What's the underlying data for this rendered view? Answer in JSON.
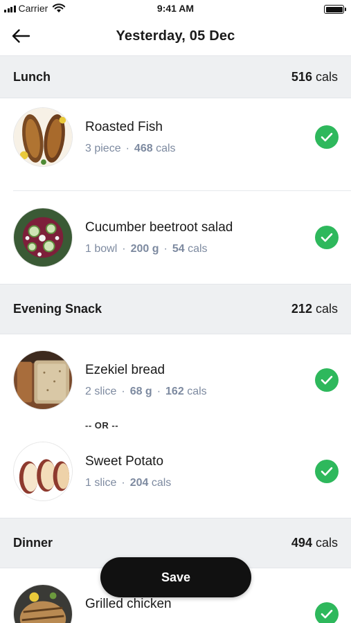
{
  "status_bar": {
    "carrier": "Carrier",
    "time": "9:41 AM"
  },
  "header": {
    "title": "Yesterday, 05 Dec"
  },
  "sections": [
    {
      "title": "Lunch",
      "cals_value": "516",
      "cals_unit": "cals",
      "items": [
        {
          "name": "Roasted Fish",
          "qty": "3 piece",
          "cals": "468",
          "unit": "cals",
          "checked": true
        },
        {
          "name": "Cucumber beetroot salad",
          "qty": "1 bowl",
          "weight": "200 g",
          "cals": "54",
          "unit": "cals",
          "checked": true
        }
      ]
    },
    {
      "title": "Evening Snack",
      "cals_value": "212",
      "cals_unit": "cals",
      "items": [
        {
          "name": "Ezekiel bread",
          "qty": "2 slice",
          "weight": "68 g",
          "cals": "162",
          "unit": "cals",
          "checked": true
        },
        {
          "name": "Sweet Potato",
          "qty": "1 slice",
          "cals": "204",
          "unit": "cals",
          "checked": true
        }
      ],
      "or_label": "-- OR --"
    },
    {
      "title": "Dinner",
      "cals_value": "494",
      "cals_unit": "cals",
      "items": [
        {
          "name": "Grilled chicken",
          "checked": true
        }
      ]
    }
  ],
  "save_button": {
    "label": "Save"
  },
  "colors": {
    "accent_green": "#2eb85c",
    "section_bg": "#eef0f2",
    "meta_text": "#7d8aa0",
    "button_bg": "#111111"
  },
  "icons": {
    "back": "arrow-left-icon",
    "check": "check-circle-icon",
    "wifi": "wifi-icon",
    "battery": "battery-icon",
    "signal": "signal-icon"
  }
}
